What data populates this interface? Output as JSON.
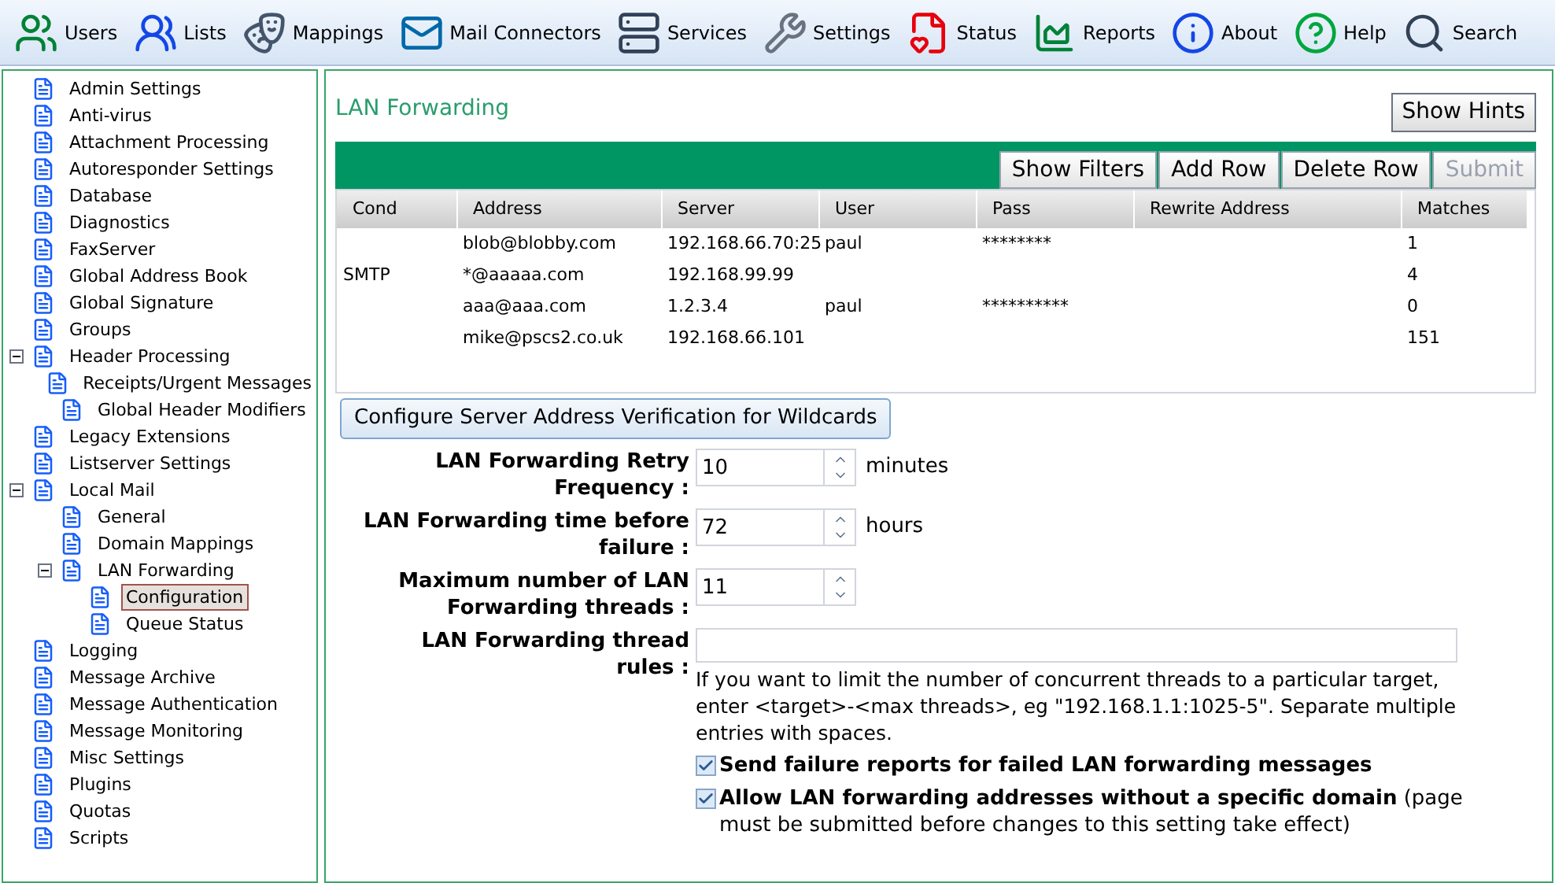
{
  "toolbar": [
    {
      "label": "Users"
    },
    {
      "label": "Lists"
    },
    {
      "label": "Mappings"
    },
    {
      "label": "Mail Connectors"
    },
    {
      "label": "Services"
    },
    {
      "label": "Settings"
    },
    {
      "label": "Status"
    },
    {
      "label": "Reports"
    },
    {
      "label": "About"
    },
    {
      "label": "Help"
    },
    {
      "label": "Search"
    }
  ],
  "sidebar": {
    "items": [
      {
        "label": "Admin Settings",
        "selected": false
      },
      {
        "label": "Anti-virus",
        "selected": false
      },
      {
        "label": "Attachment Processing",
        "selected": false
      },
      {
        "label": "Autoresponder Settings",
        "selected": false
      },
      {
        "label": "Database",
        "selected": false
      },
      {
        "label": "Diagnostics",
        "selected": false
      },
      {
        "label": "FaxServer",
        "selected": false
      },
      {
        "label": "Global Address Book",
        "selected": false
      },
      {
        "label": "Global Signature",
        "selected": false
      },
      {
        "label": "Groups",
        "selected": false
      },
      {
        "label": "Header Processing",
        "selected": false,
        "expanded": true,
        "children": [
          {
            "label": "Receipts/Urgent Messages",
            "selected": false
          },
          {
            "label": "Global Header Modifiers",
            "selected": false
          }
        ]
      },
      {
        "label": "Legacy Extensions",
        "selected": false
      },
      {
        "label": "Listserver Settings",
        "selected": false
      },
      {
        "label": "Local Mail",
        "selected": false,
        "expanded": true,
        "children": [
          {
            "label": "General",
            "selected": false
          },
          {
            "label": "Domain Mappings",
            "selected": false
          },
          {
            "label": "LAN Forwarding",
            "selected": false,
            "expanded": true,
            "children": [
              {
                "label": "Configuration",
                "selected": true
              },
              {
                "label": "Queue Status",
                "selected": false
              }
            ]
          }
        ]
      },
      {
        "label": "Logging",
        "selected": false
      },
      {
        "label": "Message Archive",
        "selected": false
      },
      {
        "label": "Message Authentication",
        "selected": false
      },
      {
        "label": "Message Monitoring",
        "selected": false
      },
      {
        "label": "Misc Settings",
        "selected": false
      },
      {
        "label": "Plugins",
        "selected": false
      },
      {
        "label": "Quotas",
        "selected": false
      },
      {
        "label": "Scripts",
        "selected": false
      }
    ]
  },
  "page": {
    "title": "LAN Forwarding",
    "hints_button": "Show Hints",
    "grid_buttons": [
      {
        "label": "Show Filters",
        "disabled": false
      },
      {
        "label": "Add Row",
        "disabled": false
      },
      {
        "label": "Delete Row",
        "disabled": false
      },
      {
        "label": "Submit",
        "disabled": true
      }
    ],
    "table": {
      "columns": [
        "Cond",
        "Address",
        "Server",
        "User",
        "Pass",
        "Rewrite Address",
        "Matches"
      ],
      "rows": [
        [
          "",
          "blob@blobby.com",
          "192.168.66.70:25",
          "paul",
          "********",
          "",
          "1"
        ],
        [
          "SMTP",
          "*@aaaaa.com",
          "192.168.99.99",
          "",
          "",
          "",
          "4"
        ],
        [
          "",
          "aaa@aaa.com",
          "1.2.3.4",
          "paul",
          "**********",
          "",
          "0"
        ],
        [
          "",
          "mike@pscs2.co.uk",
          "192.168.66.101",
          "",
          "",
          "",
          "151"
        ]
      ]
    },
    "verify_button": "Configure Server Address Verification for Wildcards",
    "fields": [
      {
        "label": "LAN Forwarding Retry Frequency :",
        "value": "10",
        "unit": "minutes",
        "kind": "spinner"
      },
      {
        "label": "LAN Forwarding time before failure :",
        "value": "72",
        "unit": "hours",
        "kind": "spinner"
      },
      {
        "label": "Maximum number of LAN Forwarding threads :",
        "value": "11",
        "kind": "spinner"
      },
      {
        "label": "LAN Forwarding thread rules :",
        "kind": "text",
        "help": "If you want to limit the number of concurrent threads to a particular target, enter <target>-<max threads>, eg \"192.168.1.1:1025-5\". Separate multiple entries with spaces."
      }
    ],
    "checkboxes": [
      {
        "label": "**Send failure reports for failed LAN forwarding messages**",
        "checked": true
      },
      {
        "label": "**Allow LAN forwarding addresses without a specific domain** (page must be submitted before changes to this setting take effect)",
        "checked": true
      }
    ]
  }
}
